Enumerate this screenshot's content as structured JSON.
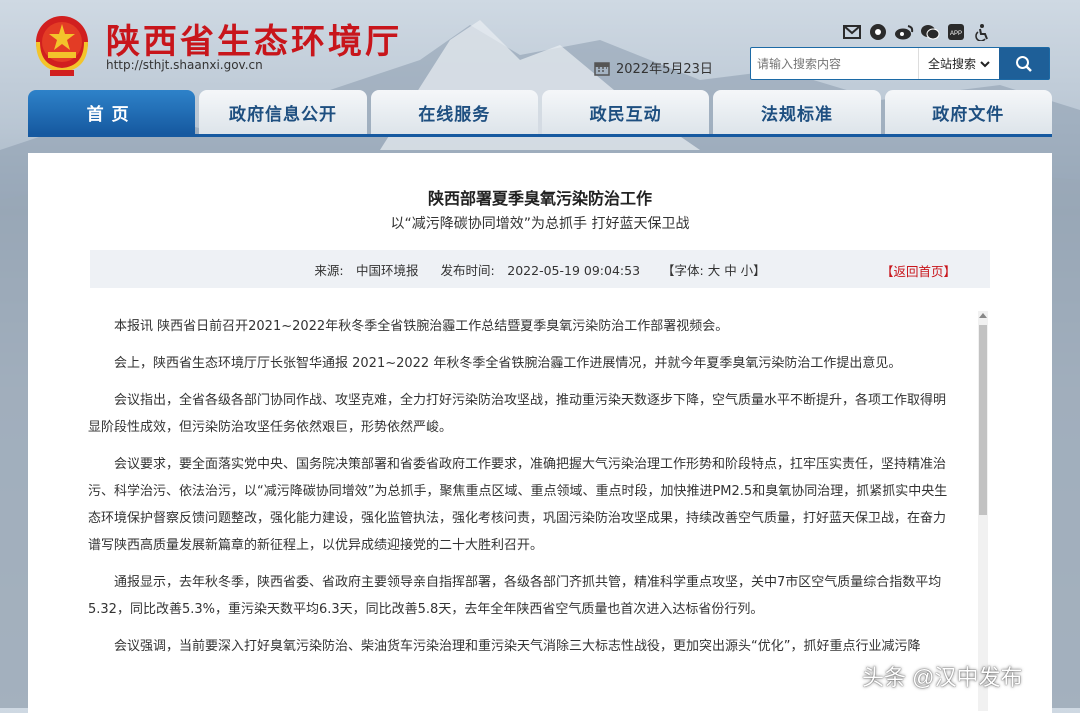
{
  "header": {
    "site_title": "陕西省生态环境厅",
    "site_url": "http://sthjt.shaanxi.gov.cn",
    "date": "2022年5月23日",
    "icons": [
      "mail-icon",
      "circle-icon",
      "weibo-icon",
      "wechat-icon",
      "app-icon",
      "accessibility-icon"
    ]
  },
  "search": {
    "placeholder": "请输入搜索内容",
    "scope": "全站搜索"
  },
  "nav": {
    "tabs": [
      "首页",
      "政府信息公开",
      "在线服务",
      "政民互动",
      "法规标准",
      "政府文件"
    ],
    "active_index": 0
  },
  "article": {
    "title": "陕西部署夏季臭氧污染防治工作",
    "subtitle": "以“减污降碳协同增效”为总抓手 打好蓝天保卫战",
    "source": "来源:　中国环境报",
    "published": "发布时间:　2022-05-19 09:04:53",
    "font_size": "【字体: 大 中 小】",
    "back_label": "【返回首页】",
    "paragraphs": [
      "本报讯 陕西省日前召开2021~2022年秋冬季全省铁腕治霾工作总结暨夏季臭氧污染防治工作部署视频会。",
      "会上，陕西省生态环境厅厅长张智华通报 2021~2022 年秋冬季全省铁腕治霾工作进展情况，并就今年夏季臭氧污染防治工作提出意见。",
      "会议指出，全省各级各部门协同作战、攻坚克难，全力打好污染防治攻坚战，推动重污染天数逐步下降，空气质量水平不断提升，各项工作取得明显阶段性成效，但污染防治攻坚任务依然艰巨，形势依然严峻。",
      "会议要求，要全面落实党中央、国务院决策部署和省委省政府工作要求，准确把握大气污染治理工作形势和阶段特点，扛牢压实责任，坚持精准治污、科学治污、依法治污，以“减污降碳协同增效”为总抓手，聚焦重点区域、重点领域、重点时段，加快推进PM2.5和臭氧协同治理，抓紧抓实中央生态环境保护督察反馈问题整改，强化能力建设，强化监管执法，强化考核问责，巩固污染防治攻坚成果，持续改善空气质量，打好蓝天保卫战，在奋力谱写陕西高质量发展新篇章的新征程上，以优异成绩迎接党的二十大胜利召开。",
      "通报显示，去年秋冬季，陕西省委、省政府主要领导亲自指挥部署，各级各部门齐抓共管，精准科学重点攻坚，关中7市区空气质量综合指数平均5.32，同比改善5.3%，重污染天数平均6.3天，同比改善5.8天，去年全年陕西省空气质量也首次进入达标省份行列。",
      "会议强调，当前要深入打好臭氧污染防治、柴油货车污染治理和重污染天气消除三大标志性战役，更加突出源头“优化”，抓好重点行业减污降"
    ]
  },
  "watermark": "头条 @汉中发布"
}
